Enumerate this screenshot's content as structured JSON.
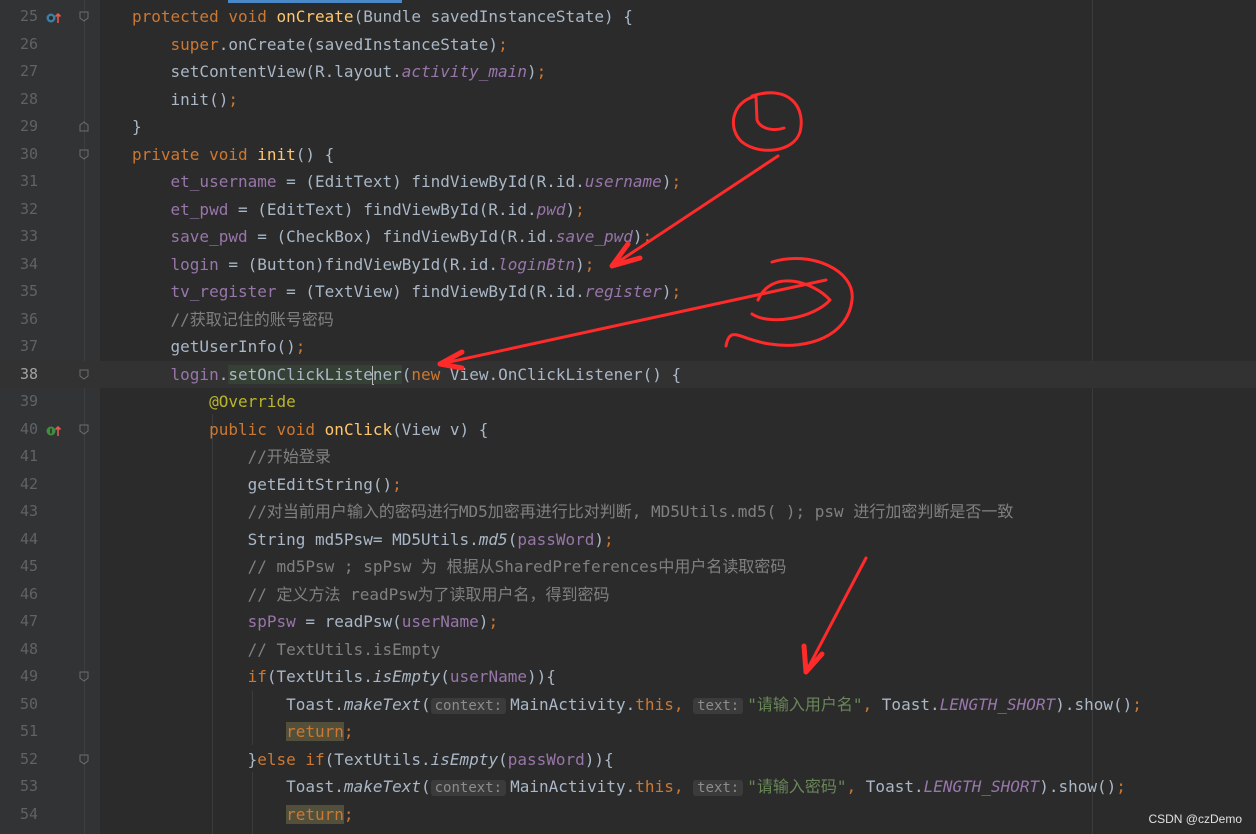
{
  "editor": {
    "lines": [
      {
        "n": "25",
        "parts": [
          [
            "kw",
            "protected "
          ],
          [
            "kw",
            "void "
          ],
          [
            "fn",
            "onCreate"
          ],
          [
            "",
            "(Bundle savedInstanceState) {"
          ]
        ]
      },
      {
        "n": "26",
        "parts": [
          [
            "",
            "    "
          ],
          [
            "kw",
            "super"
          ],
          [
            "",
            ".onCreate(savedInstanceState)"
          ],
          [
            "kw",
            ";"
          ]
        ]
      },
      {
        "n": "27",
        "parts": [
          [
            "",
            "    setContentView(R.layout."
          ],
          [
            "ifld",
            "activity_main"
          ],
          [
            "",
            ")"
          ],
          [
            "kw",
            ";"
          ]
        ]
      },
      {
        "n": "28",
        "parts": [
          [
            "",
            "    init()"
          ],
          [
            "kw",
            ";"
          ]
        ]
      },
      {
        "n": "29",
        "parts": [
          [
            "",
            "}"
          ]
        ]
      },
      {
        "n": "30",
        "parts": [
          [
            "kw",
            "private "
          ],
          [
            "kw",
            "void "
          ],
          [
            "fn",
            "init"
          ],
          [
            "",
            "() {"
          ]
        ]
      },
      {
        "n": "31",
        "parts": [
          [
            "",
            "    "
          ],
          [
            "fld",
            "et_username"
          ],
          [
            "",
            " = (EditText) findViewById(R.id."
          ],
          [
            "ifld",
            "username"
          ],
          [
            "",
            ")"
          ],
          [
            "kw",
            ";"
          ]
        ]
      },
      {
        "n": "32",
        "parts": [
          [
            "",
            "    "
          ],
          [
            "fld",
            "et_pwd"
          ],
          [
            "",
            " = (EditText) findViewById(R.id."
          ],
          [
            "ifld",
            "pwd"
          ],
          [
            "",
            ")"
          ],
          [
            "kw",
            ";"
          ]
        ]
      },
      {
        "n": "33",
        "parts": [
          [
            "",
            "    "
          ],
          [
            "fld",
            "save_pwd"
          ],
          [
            "",
            " = (CheckBox) findViewById(R.id."
          ],
          [
            "ifld",
            "save_pwd"
          ],
          [
            "",
            ")"
          ],
          [
            "kw",
            ";"
          ]
        ]
      },
      {
        "n": "34",
        "parts": [
          [
            "",
            "    "
          ],
          [
            "fld",
            "login"
          ],
          [
            "",
            " = (Button)findViewById(R.id."
          ],
          [
            "ifld",
            "loginBtn"
          ],
          [
            "",
            ")"
          ],
          [
            "kw",
            ";"
          ]
        ]
      },
      {
        "n": "35",
        "parts": [
          [
            "",
            "    "
          ],
          [
            "fld",
            "tv_register"
          ],
          [
            "",
            " = (TextView) findViewById(R.id."
          ],
          [
            "ifld",
            "register"
          ],
          [
            "",
            ")"
          ],
          [
            "kw",
            ";"
          ]
        ]
      },
      {
        "n": "36",
        "parts": [
          [
            "cm",
            "    //获取记住的账号密码"
          ]
        ]
      },
      {
        "n": "37",
        "parts": [
          [
            "",
            "    getUserInfo()"
          ],
          [
            "kw",
            ";"
          ]
        ]
      },
      {
        "n": "38",
        "current": true,
        "parts": [
          [
            "",
            "    "
          ],
          [
            "fld",
            "login"
          ],
          [
            "",
            "."
          ],
          [
            "hl",
            "setOnClickListe"
          ],
          [
            "cursor",
            ""
          ],
          [
            "hl",
            "ner"
          ],
          [
            "",
            "("
          ],
          [
            "kw",
            "new "
          ],
          [
            "",
            "View.OnClickListener() {"
          ]
        ]
      },
      {
        "n": "39",
        "parts": [
          [
            "an",
            "        @Override"
          ]
        ]
      },
      {
        "n": "40",
        "parts": [
          [
            "",
            "        "
          ],
          [
            "kw",
            "public "
          ],
          [
            "kw",
            "void "
          ],
          [
            "fn",
            "onClick"
          ],
          [
            "",
            "(View v) {"
          ]
        ]
      },
      {
        "n": "41",
        "parts": [
          [
            "cm",
            "            //开始登录"
          ]
        ]
      },
      {
        "n": "42",
        "parts": [
          [
            "",
            "            getEditString()"
          ],
          [
            "kw",
            ";"
          ]
        ]
      },
      {
        "n": "43",
        "parts": [
          [
            "cm",
            "            //对当前用户输入的密码进行MD5加密再进行比对判断, MD5Utils.md5( ); psw 进行加密判断是否一致"
          ]
        ]
      },
      {
        "n": "44",
        "parts": [
          [
            "",
            "            String md5Psw= MD5Utils."
          ],
          [
            "st",
            "md5"
          ],
          [
            "",
            "("
          ],
          [
            "fld",
            "passWord"
          ],
          [
            "",
            ")"
          ],
          [
            "kw",
            ";"
          ]
        ]
      },
      {
        "n": "45",
        "parts": [
          [
            "cm",
            "            // md5Psw ; spPsw 为 根据从SharedPreferences中用户名读取密码"
          ]
        ]
      },
      {
        "n": "46",
        "parts": [
          [
            "cm",
            "            // 定义方法 readPsw为了读取用户名，得到密码"
          ]
        ]
      },
      {
        "n": "47",
        "parts": [
          [
            "",
            "            "
          ],
          [
            "fld",
            "spPsw"
          ],
          [
            "",
            " = readPsw("
          ],
          [
            "fld",
            "userName"
          ],
          [
            "",
            ")"
          ],
          [
            "kw",
            ";"
          ]
        ]
      },
      {
        "n": "48",
        "parts": [
          [
            "cm",
            "            // TextUtils.isEmpty"
          ]
        ]
      },
      {
        "n": "49",
        "parts": [
          [
            "",
            "            "
          ],
          [
            "kw",
            "if"
          ],
          [
            "",
            "(TextUtils."
          ],
          [
            "st",
            "isEmpty"
          ],
          [
            "",
            "("
          ],
          [
            "fld",
            "userName"
          ],
          [
            "",
            "))"
          ],
          [
            "",
            "{"
          ]
        ]
      },
      {
        "n": "50",
        "parts": [
          [
            "",
            "                Toast."
          ],
          [
            "st",
            "makeText"
          ],
          [
            "",
            "("
          ],
          [
            "hint",
            "context:"
          ],
          [
            "",
            "MainActivity."
          ],
          [
            "kw",
            "this, "
          ],
          [
            "hint",
            "text:"
          ],
          [
            "str",
            "\"请输入用户名\""
          ],
          [
            "kw",
            ", "
          ],
          [
            "",
            "Toast."
          ],
          [
            "ifld",
            "LENGTH_SHORT"
          ],
          [
            "",
            ").show()"
          ],
          [
            "kw",
            ";"
          ]
        ]
      },
      {
        "n": "51",
        "parts": [
          [
            "",
            "                "
          ],
          [
            "retkw",
            "return"
          ],
          [
            "kw",
            ";"
          ]
        ]
      },
      {
        "n": "52",
        "parts": [
          [
            "",
            "            }"
          ],
          [
            "kw",
            "else if"
          ],
          [
            "",
            "(TextUtils."
          ],
          [
            "st",
            "isEmpty"
          ],
          [
            "",
            "("
          ],
          [
            "fld",
            "passWord"
          ],
          [
            "",
            "))"
          ],
          [
            "",
            "{"
          ]
        ]
      },
      {
        "n": "53",
        "parts": [
          [
            "",
            "                Toast."
          ],
          [
            "st",
            "makeText"
          ],
          [
            "",
            "("
          ],
          [
            "hint",
            "context:"
          ],
          [
            "",
            "MainActivity."
          ],
          [
            "kw",
            "this, "
          ],
          [
            "hint",
            "text:"
          ],
          [
            "str",
            "\"请输入密码\""
          ],
          [
            "kw",
            ", "
          ],
          [
            "",
            "Toast."
          ],
          [
            "ifld",
            "LENGTH_SHORT"
          ],
          [
            "",
            ").show()"
          ],
          [
            "kw",
            ";"
          ]
        ]
      },
      {
        "n": "54",
        "parts": [
          [
            "",
            "                "
          ],
          [
            "retkw",
            "return"
          ],
          [
            "kw",
            ";"
          ]
        ]
      }
    ]
  },
  "colors": {
    "background": "#2b2b2b",
    "annotation": "#ff2a2a"
  },
  "watermark": "CSDN @czDemo"
}
